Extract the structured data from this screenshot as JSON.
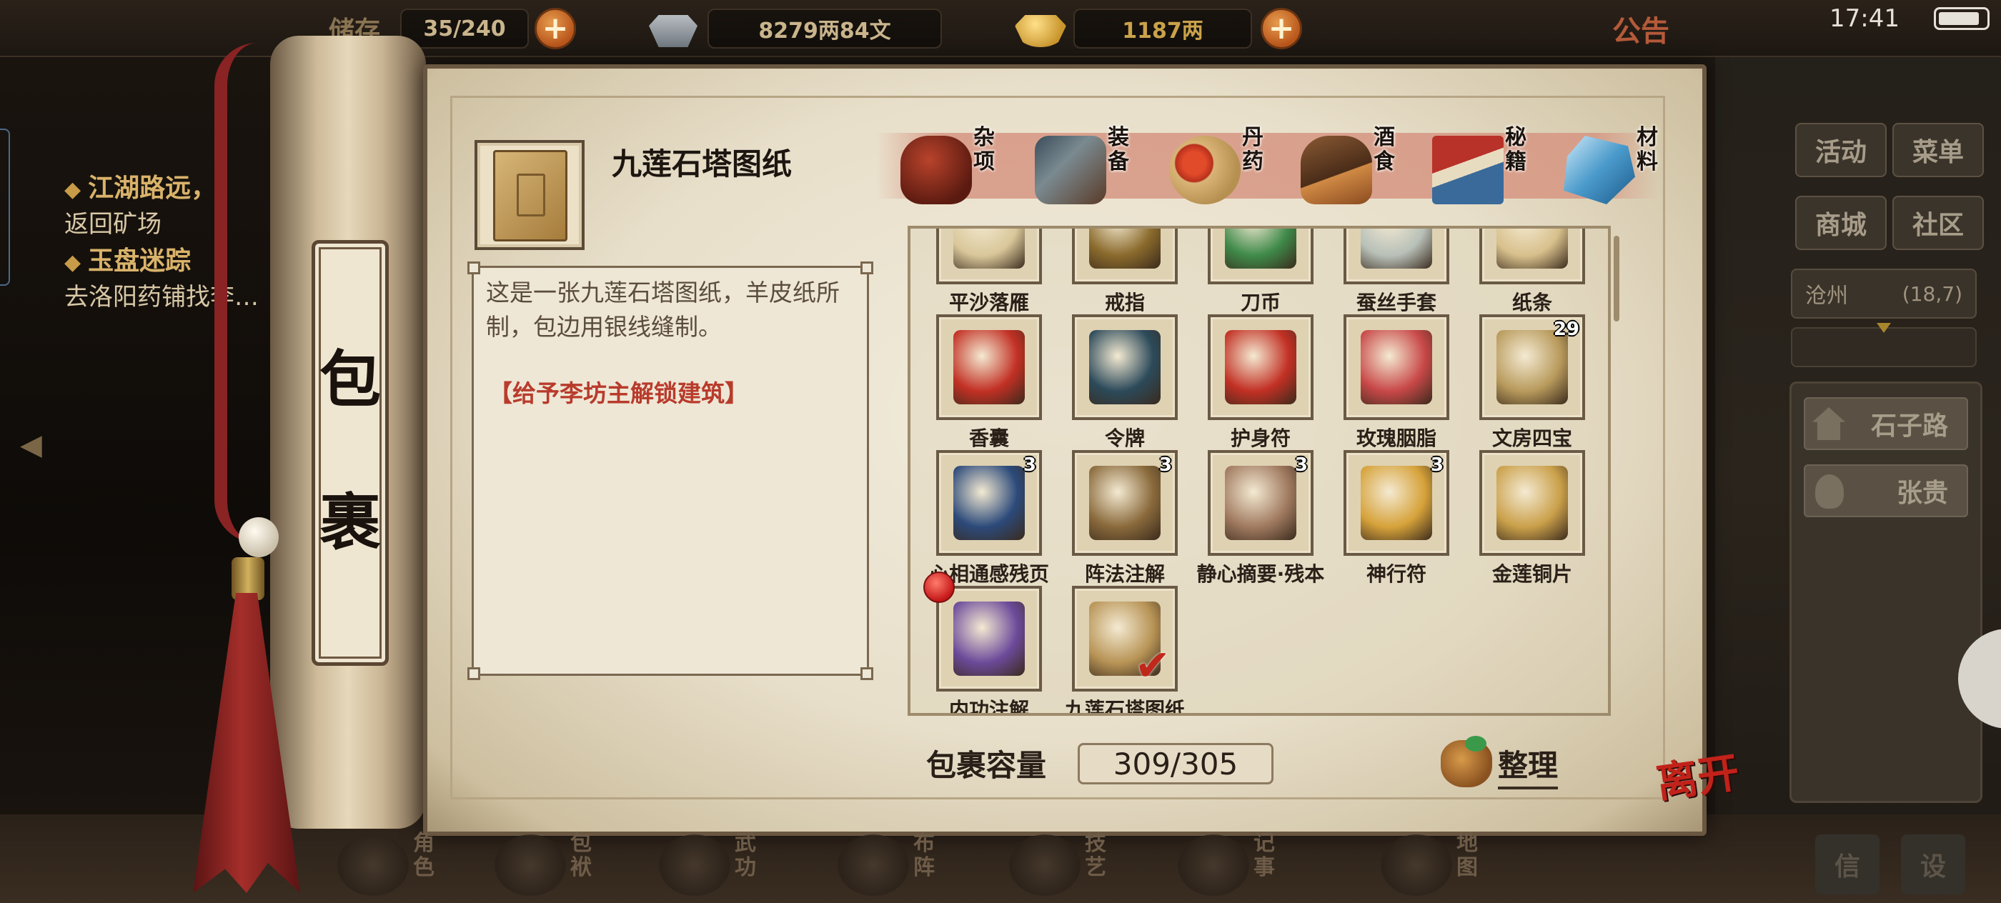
{
  "topbar": {
    "storage_label": "储存",
    "storage_count": "35/240",
    "silver": "8279两84文",
    "gold": "1187两",
    "notice": "公告",
    "time": "17:41"
  },
  "quests": [
    {
      "title": "江湖路远，",
      "desc": "返回矿场"
    },
    {
      "title": "玉盘迷踪",
      "desc": "去洛阳药铺找李…"
    }
  ],
  "scroll_title": [
    "包",
    "裹"
  ],
  "selected_item": {
    "name": "九莲石塔图纸",
    "description": "这是一张九莲石塔图纸，羊皮纸所制，包边用银线缝制。",
    "action": "【给予李坊主解锁建筑】"
  },
  "tabs": [
    {
      "label": "杂项",
      "icon": "jar-icon"
    },
    {
      "label": "装备",
      "icon": "armor-icon"
    },
    {
      "label": "丹药",
      "icon": "pills-icon"
    },
    {
      "label": "酒食",
      "icon": "food-icon"
    },
    {
      "label": "秘籍",
      "icon": "books-icon"
    },
    {
      "label": "材料",
      "icon": "crystal-icon"
    }
  ],
  "items": [
    {
      "label": "平沙落雁",
      "count": "",
      "icon": "scroll-icon",
      "color": "#d9c79a"
    },
    {
      "label": "戒指",
      "count": "",
      "icon": "ring-icon",
      "color": "#8a6a2c"
    },
    {
      "label": "刀币",
      "count": "",
      "icon": "coin-icon",
      "color": "#3f8a4a"
    },
    {
      "label": "蚕丝手套",
      "count": "",
      "icon": "glove-icon",
      "color": "#b8c0b8"
    },
    {
      "label": "纸条",
      "count": "",
      "icon": "paper-icon",
      "color": "#d8c08c"
    },
    {
      "label": "香囊",
      "count": "",
      "icon": "sachet-icon",
      "color": "#c23024"
    },
    {
      "label": "令牌",
      "count": "",
      "icon": "token-icon",
      "color": "#2c4a5a"
    },
    {
      "label": "护身符",
      "count": "",
      "icon": "amulet-icon",
      "color": "#c23024"
    },
    {
      "label": "玫瑰胭脂",
      "count": "",
      "icon": "rouge-icon",
      "color": "#c84848"
    },
    {
      "label": "文房四宝",
      "count": "29",
      "icon": "stationery-icon",
      "color": "#b89a5c"
    },
    {
      "label": "心相通感残页",
      "count": "3",
      "icon": "manual-icon",
      "color": "#2c4a7a"
    },
    {
      "label": "阵法注解",
      "count": "3",
      "icon": "book-icon",
      "color": "#8a6a3c"
    },
    {
      "label": "静心摘要·残本",
      "count": "3",
      "icon": "torn-page-icon",
      "color": "#a07a60"
    },
    {
      "label": "神行符",
      "count": "3",
      "icon": "talisman-icon",
      "color": "#d6a23a"
    },
    {
      "label": "金莲铜片",
      "count": "",
      "icon": "lotus-icon",
      "color": "#caa04a"
    },
    {
      "label": "内功注解",
      "count": "",
      "icon": "purple-scroll-icon",
      "color": "#6c4a9a",
      "new": true
    },
    {
      "label": "九莲石塔图纸",
      "count": "",
      "icon": "blueprint-icon",
      "color": "#b89456",
      "selected": true
    }
  ],
  "capacity": {
    "label": "包裹容量",
    "value": "309/305"
  },
  "sort_label": "整理",
  "leave_label": "离开",
  "right_menu": {
    "buttons": [
      "活动",
      "菜单",
      "商城",
      "社区"
    ],
    "location_name": "沧州",
    "location_coord": "(18,7)",
    "npcs": [
      "石子路",
      "张贵"
    ]
  },
  "bottom_nav": [
    "角色",
    "包袱",
    "武功",
    "布阵",
    "技艺",
    "记事",
    "地图"
  ],
  "colors": {
    "accent_red": "#b83b2c",
    "parchment": "#e8dfca",
    "wood": "#6a5741"
  }
}
